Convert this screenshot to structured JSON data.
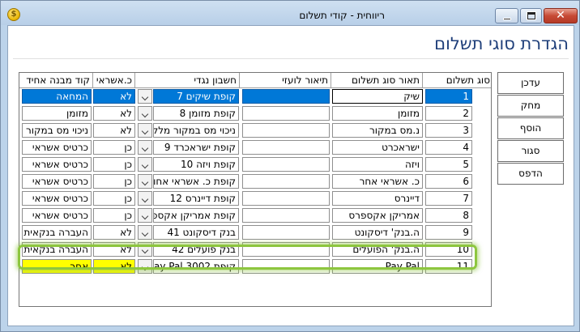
{
  "window": {
    "title": "ריווחית - קודי תשלום",
    "icon": "app-coin-icon"
  },
  "page": {
    "title": "הגדרת סוגי תשלום"
  },
  "side_buttons": [
    {
      "label": "עדכן"
    },
    {
      "label": "מחק"
    },
    {
      "label": "הוסף"
    },
    {
      "label": "סגור"
    },
    {
      "label": "הדפס"
    }
  ],
  "table": {
    "headers": {
      "code": "סוג תשלום",
      "desc": "תאור סוג תשלום",
      "foreign": "תיאור לועזי",
      "account": "חשבון נגדי",
      "credit": "כ.אשראי",
      "unified": "קוד מבנה אחיד"
    },
    "rows": [
      {
        "code": "1",
        "desc": "שיק",
        "foreign": "",
        "account": "קופת שיקים  7",
        "credit": "לא",
        "unified": "המחאה"
      },
      {
        "code": "2",
        "desc": "מזומן",
        "foreign": "",
        "account": "קופת מזומן  8",
        "credit": "לא",
        "unified": "מזומן"
      },
      {
        "code": "3",
        "desc": "נ.מס במקור",
        "foreign": "",
        "account": "ניכוי מס במקור מלקו",
        "credit": "לא",
        "unified": "ניכוי מס במקור"
      },
      {
        "code": "4",
        "desc": "ישראכרט",
        "foreign": "",
        "account": "קופת ישראכרד  9",
        "credit": "כן",
        "unified": "כרטיס אשראי"
      },
      {
        "code": "5",
        "desc": "ויזה",
        "foreign": "",
        "account": "קופת ויזה  10",
        "credit": "כן",
        "unified": "כרטיס אשראי"
      },
      {
        "code": "6",
        "desc": "כ. אשראי אחר",
        "foreign": "",
        "account": "קופת כ. אשראי  אחו",
        "credit": "כן",
        "unified": "כרטיס אשראי"
      },
      {
        "code": "7",
        "desc": "דיינרס",
        "foreign": "",
        "account": "קופת דיינרס  12",
        "credit": "כן",
        "unified": "כרטיס אשראי"
      },
      {
        "code": "8",
        "desc": "אמריקן אקספרס",
        "foreign": "",
        "account": "קופת אמריקן אקספר",
        "credit": "כן",
        "unified": "כרטיס אשראי"
      },
      {
        "code": "9",
        "desc": "ה.בנק' דיסקונט",
        "foreign": "",
        "account": "בנק דיסקונט  41",
        "credit": "לא",
        "unified": "העברה בנקאית"
      },
      {
        "code": "10",
        "desc": "ה.בנק' הפועלים",
        "foreign": "",
        "account": "בנק פועלים  42",
        "credit": "לא",
        "unified": "העברה בנקאית"
      },
      {
        "code": "11",
        "desc": "Pay Pal",
        "foreign": "",
        "account": "קופת  3002  ay Pal",
        "credit": "לא",
        "unified": "אחר"
      }
    ]
  },
  "colors": {
    "selection": "#0078d7",
    "highlight_fill": "#ffff00",
    "highlight_frame": "#8dc63f",
    "title_blue": "#1f3f7a"
  }
}
